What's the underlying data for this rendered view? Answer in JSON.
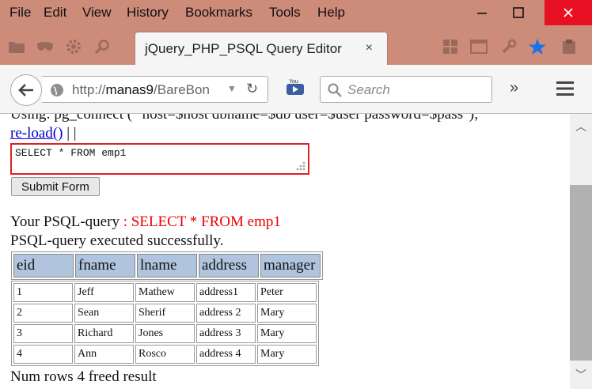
{
  "menu": [
    "File",
    "Edit",
    "View",
    "History",
    "Bookmarks",
    "Tools",
    "Help"
  ],
  "tab": {
    "title": "jQuery_PHP_PSQL Query Editor",
    "close": "×"
  },
  "url": {
    "prefix": "http://",
    "host": "manas9",
    "path": "/BareBon"
  },
  "search": {
    "placeholder": "Search"
  },
  "page": {
    "cut_line": "Using: pg_connect ( \"host=$host dbname=$db user=$user password=$pass\");",
    "reload_link": "re-load()",
    "separators": " | |",
    "query_value": "SELECT * FROM emp1",
    "submit_label": "Submit Form",
    "your_query_label": "Your PSQL-query",
    "your_query_value": " : SELECT * FROM emp1",
    "executed": "PSQL-query executed successfully.",
    "num_rows": "Num rows 4 freed result"
  },
  "table": {
    "headers": [
      "eid",
      "fname",
      "lname",
      "address",
      "manager"
    ],
    "rows": [
      [
        "1",
        "Jeff",
        "Mathew",
        "address1",
        "Peter"
      ],
      [
        "2",
        "Sean",
        "Sherif",
        "address 2",
        "Mary"
      ],
      [
        "3",
        "Richard",
        "Jones",
        "address 3",
        "Mary"
      ],
      [
        "4",
        "Ann",
        "Rosco",
        "address 4",
        "Mary"
      ]
    ]
  }
}
